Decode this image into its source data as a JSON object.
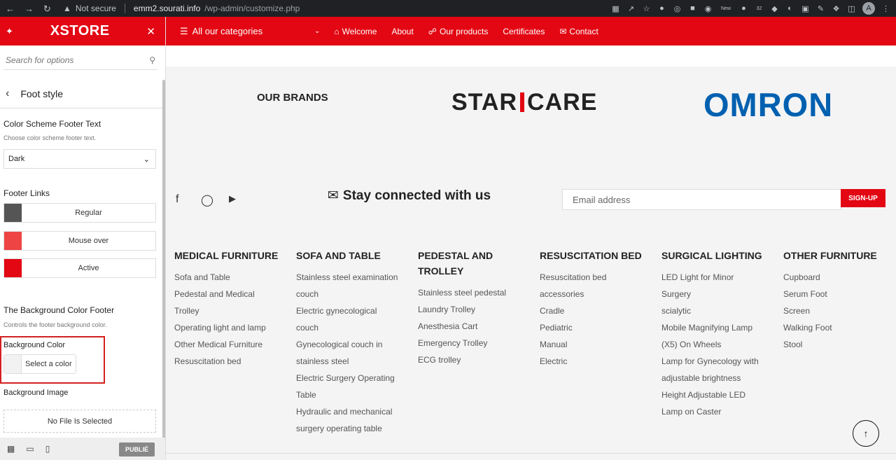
{
  "browser": {
    "security": "Not secure",
    "host": "emm2.sourati.info",
    "path": "/wp-admin/customize.php",
    "avatar_letter": "A",
    "ext_new_badge": "New",
    "ext_count_badge": "32"
  },
  "customizer": {
    "logo": "XSTORE",
    "search_placeholder": "Search for options",
    "section_title": "Foot style",
    "color_scheme": {
      "label": "Color Scheme Footer Text",
      "description": "Choose color scheme footer text.",
      "value": "Dark"
    },
    "footer_links": {
      "label": "Footer Links",
      "rows": [
        {
          "label": "Regular",
          "color": "#555555"
        },
        {
          "label": "Mouse over",
          "color": "#ee4444"
        },
        {
          "label": "Active",
          "color": "#e30613"
        }
      ]
    },
    "bg_footer": {
      "label": "The Background Color Footer",
      "description": "Controls the footer background color.",
      "bg_color_label": "Background Color",
      "select_color": "Select a color",
      "bg_image_label": "Background Image",
      "no_file": "No File Is Selected"
    },
    "publish": "PUBLIÉ"
  },
  "nav": {
    "categories": "All our categories",
    "items": [
      "Welcome",
      "About",
      "Our products",
      "Certificates",
      "Contact"
    ]
  },
  "brands": {
    "title": "OUR BRANDS",
    "staricare_left": "STAR",
    "staricare_right": "CARE",
    "omron": "OMRON"
  },
  "newsletter": {
    "title": "Stay connected with us",
    "placeholder": "Email address",
    "button": "SIGN-UP"
  },
  "columns": [
    {
      "title": "MEDICAL FURNITURE",
      "links": [
        "Sofa and Table",
        "Pedestal and Medical",
        "Trolley",
        "Operating light and lamp",
        "Other Medical Furniture",
        "Resuscitation bed"
      ]
    },
    {
      "title": "SOFA AND TABLE",
      "links": [
        "Stainless steel examination",
        "couch",
        "Electric gynecological",
        "couch",
        "Gynecological couch in",
        "stainless steel",
        "Electric Surgery Operating",
        "Table",
        "Hydraulic and mechanical",
        "surgery operating table"
      ]
    },
    {
      "title": "PEDESTAL AND TROLLEY",
      "links": [
        "Stainless steel pedestal",
        "Laundry Trolley",
        "Anesthesia Cart",
        "Emergency Trolley",
        "ECG trolley"
      ]
    },
    {
      "title": "RESUSCITATION BED",
      "links": [
        "Resuscitation bed",
        "accessories",
        "Cradle",
        "Pediatric",
        "Manual",
        "Electric"
      ]
    },
    {
      "title": "SURGICAL LIGHTING",
      "links": [
        "LED Light for Minor",
        "Surgery",
        "scialytic",
        "Mobile Magnifying Lamp",
        "(X5) On Wheels",
        "Lamp for Gynecology with",
        "adjustable brightness",
        "Height Adjustable LED",
        "Lamp on Caster"
      ]
    },
    {
      "title": "OTHER FURNITURE",
      "links": [
        "Cupboard",
        "Serum Foot",
        "Screen",
        "Walking Foot",
        "Stool"
      ]
    }
  ]
}
